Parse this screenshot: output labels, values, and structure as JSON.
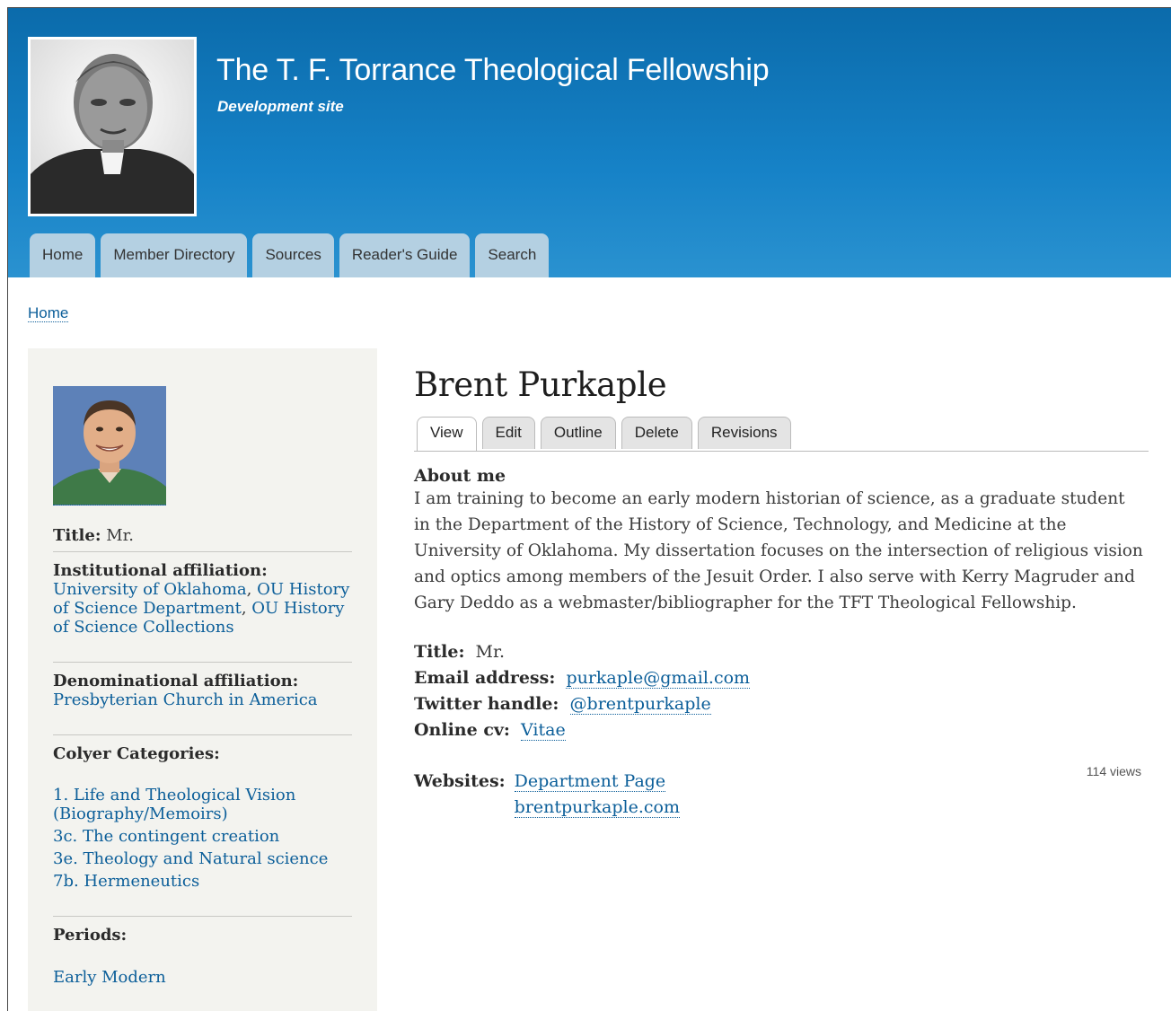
{
  "site": {
    "name": "The T. F. Torrance Theological Fellowship",
    "slogan": "Development site"
  },
  "nav": {
    "items": [
      "Home",
      "Member Directory",
      "Sources",
      "Reader's Guide",
      "Search"
    ]
  },
  "breadcrumb": {
    "home": "Home"
  },
  "sidebar": {
    "title_label": "Title:",
    "title_value": "Mr.",
    "institutional_label": "Institutional affiliation:",
    "institutional_links": [
      "University of Oklahoma",
      "OU History of Science Department",
      "OU History of Science Collections"
    ],
    "denominational_label": "Denominational affiliation:",
    "denominational_link": "Presbyterian Church in America",
    "colyer_label": "Colyer Categories:",
    "colyer_links": [
      "1. Life and Theological Vision (Biography/Memoirs)",
      "3c. The contingent creation",
      "3e. Theology and Natural science",
      "7b. Hermeneutics"
    ],
    "periods_label": "Periods:",
    "periods_link": "Early Modern"
  },
  "main": {
    "title": "Brent Purkaple",
    "tabs": [
      "View",
      "Edit",
      "Outline",
      "Delete",
      "Revisions"
    ],
    "about_heading": "About me",
    "about_text": "I am training to become an early modern historian of science, as a graduate student in the Department of the History of Science, Technology, and Medicine at the University of Oklahoma. My dissertation focuses on the intersection of religious vision and optics among members of the Jesuit Order. I also serve with Kerry Magruder and Gary Deddo as a webmaster/bibliographer for the TFT Theological Fellowship.",
    "title_label": "Title:",
    "title_value": "Mr.",
    "email_label": "Email address:",
    "email_value": "purkaple@gmail.com",
    "twitter_label": "Twitter handle:",
    "twitter_value": "@brentpurkaple",
    "cv_label": "Online cv:",
    "cv_value": "Vitae",
    "views": "114 views",
    "websites_label": "Websites:",
    "websites": [
      "Department Page",
      "brentpurkaple.com"
    ]
  }
}
